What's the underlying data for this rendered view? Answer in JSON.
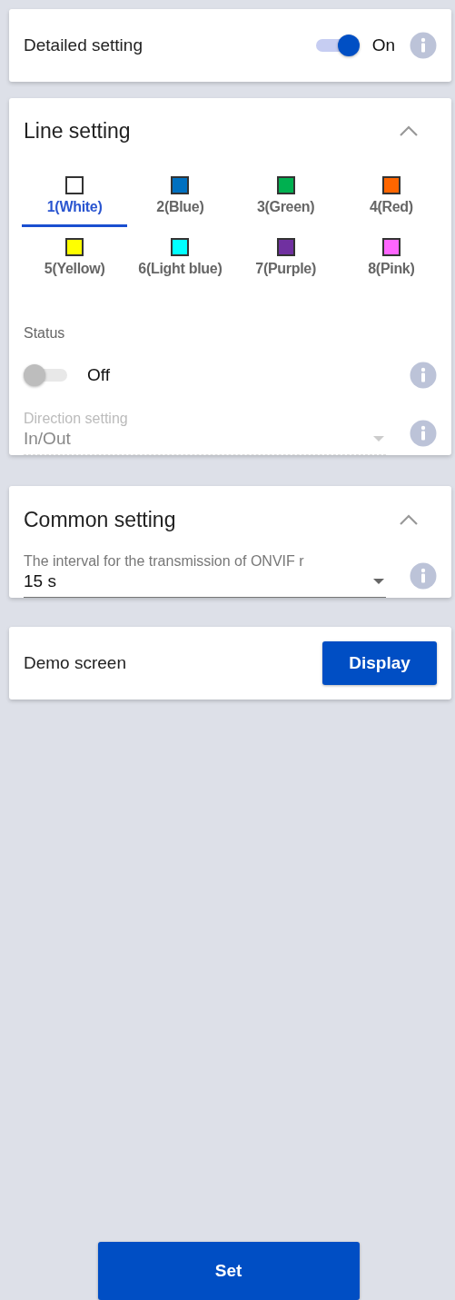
{
  "detailed_setting": {
    "label": "Detailed setting",
    "on": true,
    "state_text": "On"
  },
  "line_setting": {
    "title": "Line setting",
    "expanded": true,
    "lines": [
      {
        "label": "1(White)",
        "color": "#ffffff",
        "selected": true
      },
      {
        "label": "2(Blue)",
        "color": "#0070c0",
        "selected": false
      },
      {
        "label": "3(Green)",
        "color": "#00b050",
        "selected": false
      },
      {
        "label": "4(Red)",
        "color": "#ff6600",
        "selected": false
      },
      {
        "label": "5(Yellow)",
        "color": "#ffff00",
        "selected": false
      },
      {
        "label": "6(Light blue)",
        "color": "#00ffff",
        "selected": false
      },
      {
        "label": "7(Purple)",
        "color": "#7030a0",
        "selected": false
      },
      {
        "label": "8(Pink)",
        "color": "#ff66ff",
        "selected": false
      }
    ],
    "status": {
      "label": "Status",
      "on": false,
      "state_text": "Off"
    },
    "direction": {
      "label": "Direction setting",
      "value": "In/Out",
      "disabled": true
    }
  },
  "common_setting": {
    "title": "Common setting",
    "expanded": true,
    "interval": {
      "label": "The interval for the transmission of ONVIF r",
      "value": "15 s",
      "disabled": false
    }
  },
  "demo_screen": {
    "label": "Demo screen",
    "button": "Display"
  },
  "set_button": "Set"
}
